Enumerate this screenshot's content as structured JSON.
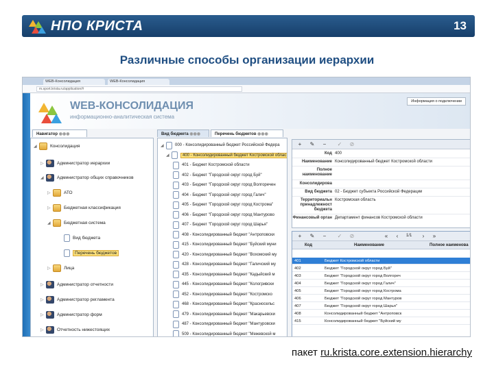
{
  "header": {
    "brand": "НПО КРИСТА",
    "page_number": "13"
  },
  "slide": {
    "title": "Различные способы организации иерархии"
  },
  "browser": {
    "tabs": [
      "WEB-Консолидация",
      "WEB-Консолидация"
    ],
    "url": "m.sport.krista.ru/application/#"
  },
  "app": {
    "banner_title": "WEB-КОНСОЛИДАЦИЯ",
    "banner_subtitle": "информационно-аналитическая система",
    "info_button": "Информация о подключении"
  },
  "navigator": {
    "tab_label": "Навигатор",
    "items": [
      {
        "label": "Консолидация",
        "icon": "consolidation-icon",
        "selected": false
      },
      {
        "label": "Администратор иерархии",
        "icon": "admin-user-icon",
        "selected": false
      },
      {
        "label": "Администратор общих справочников",
        "icon": "admin-user-icon",
        "selected": false
      },
      {
        "label": "АТО",
        "icon": "folder-icon",
        "selected": false
      },
      {
        "label": "Бюджетная классификация",
        "icon": "folder-icon",
        "selected": false
      },
      {
        "label": "Бюджетная система",
        "icon": "folder-icon",
        "selected": false
      },
      {
        "label": "Вид бюджета",
        "icon": "document-icon",
        "selected": false
      },
      {
        "label": "Перечень бюджетов",
        "icon": "document-icon",
        "selected": true
      },
      {
        "label": "Лица",
        "icon": "folder-icon",
        "selected": false
      },
      {
        "label": "Администратор отчетности",
        "icon": "admin-user-icon",
        "selected": false
      },
      {
        "label": "Администратор регламента",
        "icon": "admin-user-icon",
        "selected": false
      },
      {
        "label": "Администратор форм",
        "icon": "admin-user-icon",
        "selected": false
      },
      {
        "label": "Отчетность нижестоящих",
        "icon": "admin-user-icon",
        "selected": false
      }
    ]
  },
  "budget_tabs": {
    "tab1": "Вид бюджета",
    "tab2": "Перечень бюджетов"
  },
  "budget_tree": [
    {
      "text": "000 - Консолидированный бюджет Российской Федера",
      "selected": false
    },
    {
      "text": "400 - Консолидированный бюджет Костромской облас",
      "selected": true
    },
    {
      "text": "401 - Бюджет Костромской области",
      "selected": false
    },
    {
      "text": "402 - Бюджет \"Городской округ город Буй\"",
      "selected": false
    },
    {
      "text": "403 - Бюджет \"Городской округ город Волгоречен",
      "selected": false
    },
    {
      "text": "404 - Бюджет \"Городской округ город Галич\"",
      "selected": false
    },
    {
      "text": "405 - Бюджет \"Городской округ город Кострома\"",
      "selected": false
    },
    {
      "text": "406 - Бюджет \"Городской округ город Мантурово",
      "selected": false
    },
    {
      "text": "407 - Бюджет \"Городской округ город Шарья\"",
      "selected": false
    },
    {
      "text": "408 - Консолидированный бюджет \"Антроповски",
      "selected": false
    },
    {
      "text": "415 - Консолидированный бюджет \"Буйский муни",
      "selected": false
    },
    {
      "text": "420 - Консолидированный бюджет \"Вохомский му",
      "selected": false
    },
    {
      "text": "428 - Консолидированный бюджет \"Галичский му",
      "selected": false
    },
    {
      "text": "435 - Консолидированный бюджет \"Кадыйский м",
      "selected": false
    },
    {
      "text": "445 - Консолидированный бюджет \"Кологривски",
      "selected": false
    },
    {
      "text": "452 - Консолидированный бюджет \"Костромско",
      "selected": false
    },
    {
      "text": "468 - Консолидированный бюджет \"Красносельс",
      "selected": false
    },
    {
      "text": "479 - Консолидированный бюджет \"Макарьевски",
      "selected": false
    },
    {
      "text": "487 - Консолидированный бюджет \"Мантуровски",
      "selected": false
    },
    {
      "text": "509 - Консолидированный бюджет \"Межевской м",
      "selected": false
    }
  ],
  "form": {
    "fields": [
      {
        "label": "Код",
        "value": "400"
      },
      {
        "label": "Наименование",
        "value": "Консолидированный бюджет Костромской области"
      },
      {
        "label": "Полное наименование",
        "value": ""
      },
      {
        "label": "Консолидирова",
        "value": ""
      },
      {
        "label": "Вид бюджета",
        "value": "02 - Бюджет субъекта Российской Федерации"
      },
      {
        "label": "Территориальн принадлежност бюджета",
        "value": "Костромская область"
      },
      {
        "label": "Финансовый орган",
        "value": "Департамент финансов Костромской области"
      }
    ]
  },
  "table": {
    "page": "1/1",
    "columns": [
      "Код",
      "Наименование",
      "Полное наименова"
    ],
    "rows": [
      {
        "code": "401",
        "name": "Бюджет Костромской области",
        "selected": true
      },
      {
        "code": "402",
        "name": "Бюджет \"Городской округ город Буй\"",
        "selected": false
      },
      {
        "code": "403",
        "name": "Бюджет \"Городской округ город Волгореч",
        "selected": false
      },
      {
        "code": "404",
        "name": "Бюджет \"Городской округ город Галич\"",
        "selected": false
      },
      {
        "code": "405",
        "name": "Бюджет \"Городской округ город Кострома",
        "selected": false
      },
      {
        "code": "406",
        "name": "Бюджет \"Городской округ город Мантуров",
        "selected": false
      },
      {
        "code": "407",
        "name": "Бюджет \"Городской округ город Шарья\"",
        "selected": false
      },
      {
        "code": "408",
        "name": "Консолидированный бюджет \"Антроповск",
        "selected": false
      },
      {
        "code": "415",
        "name": "Консолидированный бюджет \"Буйский му",
        "selected": false
      }
    ]
  },
  "footer": {
    "prefix": "пакет ",
    "package": "ru.krista.core.extension.hierarchy"
  }
}
